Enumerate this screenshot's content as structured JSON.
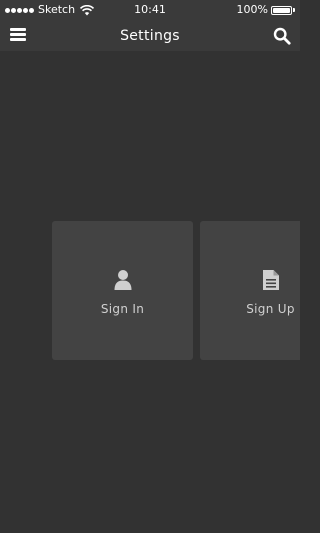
{
  "status_bar": {
    "carrier": "Sketch",
    "time": "10:41",
    "battery": "100%"
  },
  "navbar": {
    "title": "Settings"
  },
  "tiles": [
    {
      "label": "Sign In",
      "icon": "user-icon"
    },
    {
      "label": "Sign Up",
      "icon": "document-icon"
    }
  ],
  "colors": {
    "background": "#323232",
    "bar": "#3a3a3a",
    "tile": "#434343"
  }
}
